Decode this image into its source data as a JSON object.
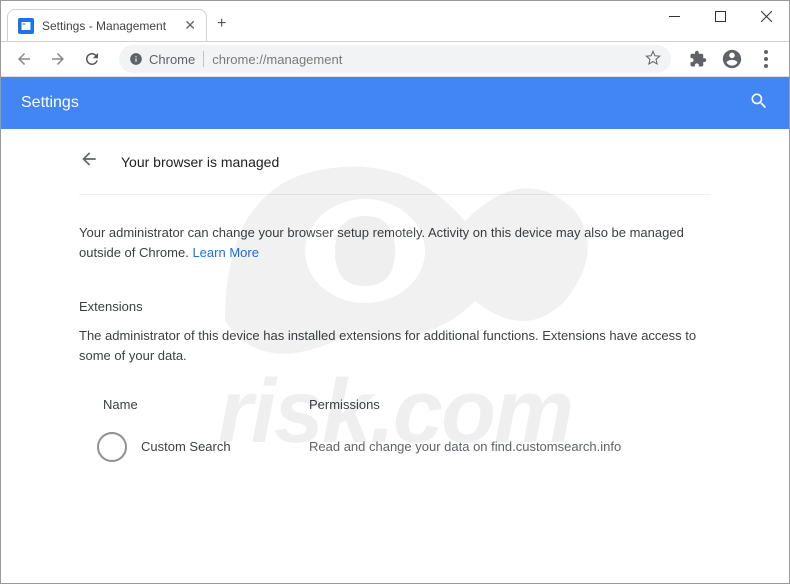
{
  "window": {
    "tab_title": "Settings - Management"
  },
  "toolbar": {
    "secure_label": "Chrome",
    "url": "chrome://management"
  },
  "header": {
    "title": "Settings"
  },
  "page": {
    "title": "Your browser is managed",
    "info_text": "Your administrator can change your browser setup remotely. Activity on this device may also be managed outside of Chrome. ",
    "learn_more": "Learn More",
    "extensions_heading": "Extensions",
    "extensions_info": "The administrator of this device has installed extensions for additional functions. Extensions have access to some of your data.",
    "col_name": "Name",
    "col_permissions": "Permissions",
    "ext_name": "Custom Search",
    "ext_permission": "Read and change your data on find.customsearch.info"
  },
  "watermark_text": "risk.com"
}
